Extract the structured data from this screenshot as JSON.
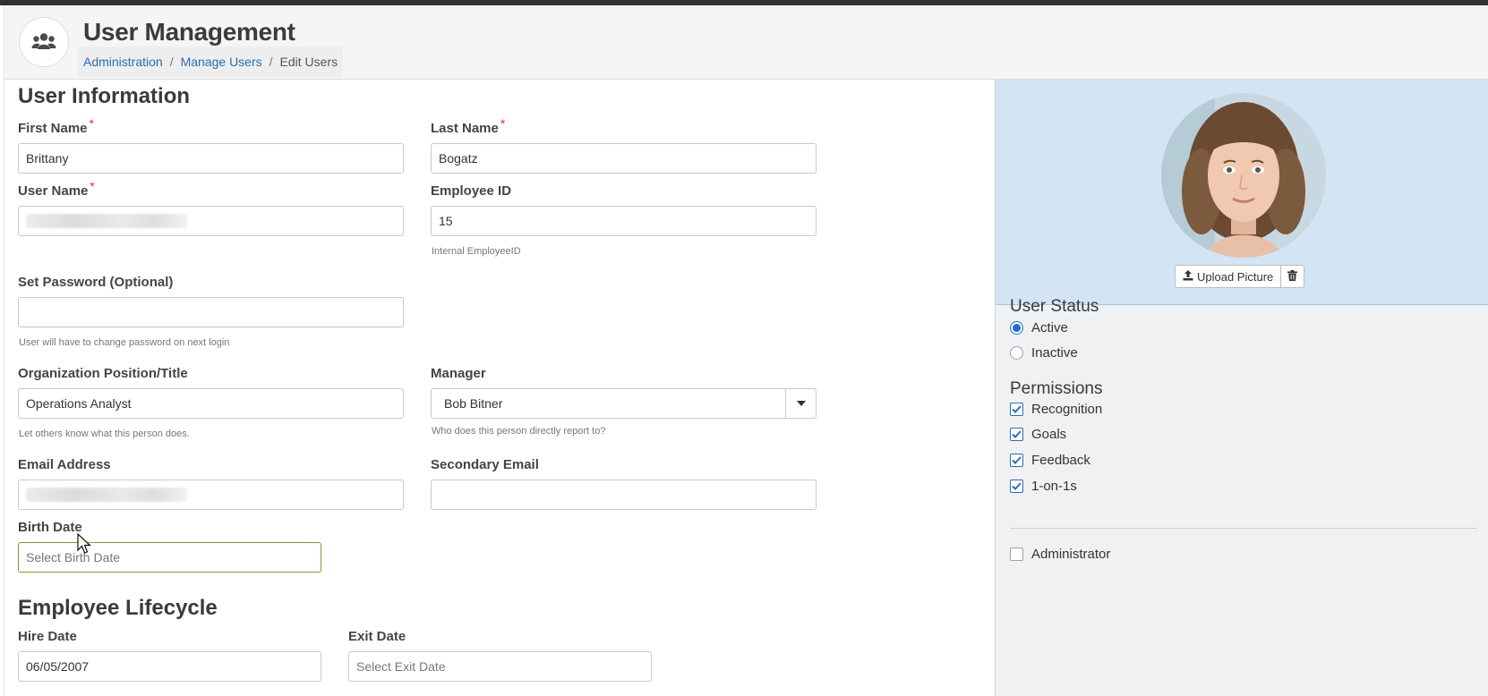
{
  "header": {
    "title": "User Management",
    "breadcrumb": [
      "Administration",
      "Manage Users",
      "Edit Users"
    ],
    "breadcrumb_sep": "/"
  },
  "user_info": {
    "title": "User Information",
    "first_name": {
      "label": "First Name",
      "required": "*",
      "value": "Brittany"
    },
    "last_name": {
      "label": "Last Name",
      "required": "*",
      "value": "Bogatz"
    },
    "user_name": {
      "label": "User Name",
      "required": "*"
    },
    "employee_id": {
      "label": "Employee ID",
      "value": "15",
      "help": "Internal EmployeeID"
    },
    "password": {
      "label": "Set Password (Optional)",
      "value": "",
      "help": "User will have to change password on next login"
    },
    "position": {
      "label": "Organization Position/Title",
      "value": "Operations Analyst",
      "help": "Let others know what this person does."
    },
    "manager": {
      "label": "Manager",
      "value": "Bob Bitner",
      "help": "Who does this person directly report to?"
    },
    "email": {
      "label": "Email Address"
    },
    "secondary_email": {
      "label": "Secondary Email",
      "value": ""
    },
    "birth_date": {
      "label": "Birth Date",
      "placeholder": "Select Birth Date"
    }
  },
  "lifecycle": {
    "title": "Employee Lifecycle",
    "hire_date": {
      "label": "Hire Date",
      "value": "06/05/2007"
    },
    "exit_date": {
      "label": "Exit Date",
      "placeholder": "Select Exit Date"
    }
  },
  "photo": {
    "upload_label": "Upload Picture"
  },
  "status": {
    "title": "User Status",
    "options": [
      {
        "label": "Active",
        "selected": true
      },
      {
        "label": "Inactive",
        "selected": false
      }
    ]
  },
  "permissions": {
    "title": "Permissions",
    "items": [
      {
        "label": "Recognition",
        "checked": true
      },
      {
        "label": "Goals",
        "checked": true
      },
      {
        "label": "Feedback",
        "checked": true
      },
      {
        "label": "1-on-1s",
        "checked": true
      }
    ],
    "admin": {
      "label": "Administrator",
      "checked": false
    }
  },
  "colors": {
    "accent": "#1f6fc5",
    "link": "#2b6cb0",
    "photo_panel": "#d3e4f4",
    "active_border": "#7a9d3a"
  }
}
